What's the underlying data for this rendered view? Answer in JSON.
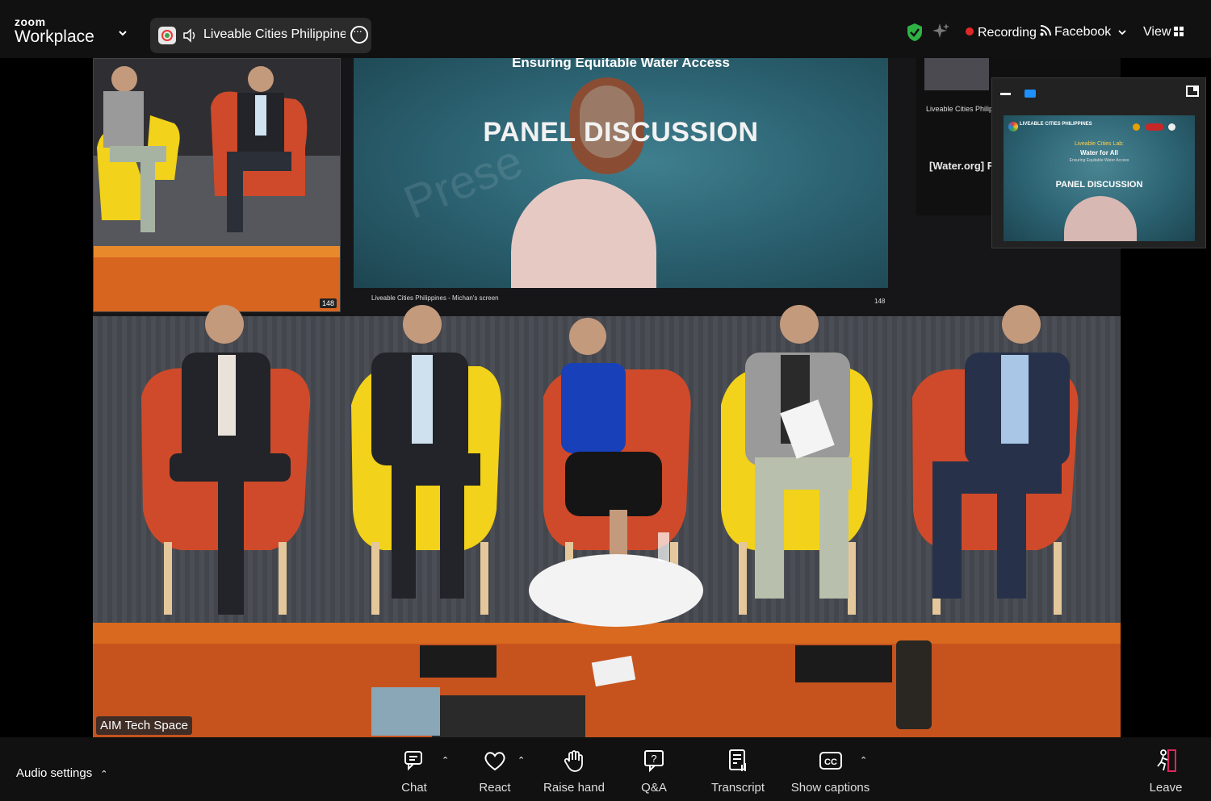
{
  "top": {
    "brand_small": "zoom",
    "brand_large": "Workplace",
    "meeting_title": "Liveable Cities Philippines - M",
    "recording_label": "Recording",
    "livestream_label": "Facebook",
    "view_label": "View"
  },
  "video": {
    "speaker_name": "AIM Tech Space",
    "slide_heading": "Ensuring Equitable Water Access",
    "slide_title": "PANEL DISCUSSION",
    "slide_watermark": "Prese",
    "screen_label": "Liveable Cities Philippines - Michan's screen",
    "screen_count": "148",
    "mini_count": "148",
    "right_screen_label": "Liveable Cities Philipp",
    "right_screen_text": "[Water.org] R"
  },
  "share_preview": {
    "org": "LIVEABLE CITIES PHILIPPINES",
    "line1": "Liveable Cities Lab:",
    "line2": "Water for All",
    "line3": "Ensuring Equitable Water Access",
    "title": "PANEL DISCUSSION"
  },
  "toolbar": {
    "audio_settings": "Audio settings",
    "items": [
      {
        "label": "Chat",
        "icon": "chat-icon"
      },
      {
        "label": "React",
        "icon": "heart-icon"
      },
      {
        "label": "Raise hand",
        "icon": "hand-icon"
      },
      {
        "label": "Q&A",
        "icon": "question-icon"
      },
      {
        "label": "Transcript",
        "icon": "transcript-icon"
      },
      {
        "label": "Show captions",
        "icon": "captions-icon"
      }
    ],
    "leave": "Leave"
  },
  "colors": {
    "recording_dot": "#e02828",
    "shield": "#2fb344",
    "accent_blue": "#1e90ff",
    "leave_red": "#e0245e"
  }
}
